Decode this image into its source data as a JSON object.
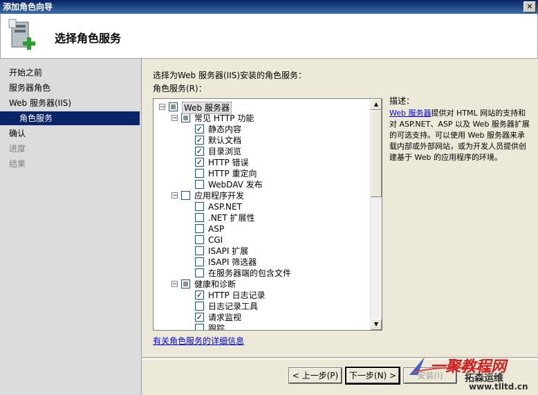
{
  "window": {
    "title": "添加角色向导",
    "close_symbol": "✕"
  },
  "header": {
    "title": "选择角色服务",
    "icon": "server-role-add-icon"
  },
  "nav": {
    "items": [
      {
        "label": "开始之前",
        "state": "normal"
      },
      {
        "label": "服务器角色",
        "state": "normal"
      },
      {
        "label": "Web 服务器(IIS)",
        "state": "normal"
      },
      {
        "label": "角色服务",
        "state": "selected"
      },
      {
        "label": "确认",
        "state": "normal"
      },
      {
        "label": "进度",
        "state": "disabled"
      },
      {
        "label": "结果",
        "state": "disabled"
      }
    ]
  },
  "main": {
    "instruction": "选择为Web 服务器(IIS)安装的角色服务：",
    "list_label": "角色服务(R)：",
    "more_info_link": "有关角色服务的详细信息"
  },
  "tree": {
    "items": [
      {
        "label": "Web 服务器",
        "level": 0,
        "expander": "⊟",
        "check": "partial",
        "selected": true
      },
      {
        "label": "常见 HTTP 功能",
        "level": 1,
        "expander": "⊟",
        "check": "partial"
      },
      {
        "label": "静态内容",
        "level": 2,
        "check": "checked"
      },
      {
        "label": "默认文档",
        "level": 2,
        "check": "checked"
      },
      {
        "label": "目录浏览",
        "level": 2,
        "check": "checked"
      },
      {
        "label": "HTTP 错误",
        "level": 2,
        "check": "checked"
      },
      {
        "label": "HTTP 重定向",
        "level": 2,
        "check": "unchecked"
      },
      {
        "label": "WebDAV 发布",
        "level": 2,
        "check": "unchecked"
      },
      {
        "label": "应用程序开发",
        "level": 1,
        "expander": "⊟",
        "check": "unchecked"
      },
      {
        "label": "ASP.NET",
        "level": 2,
        "check": "unchecked"
      },
      {
        "label": ".NET 扩展性",
        "level": 2,
        "check": "unchecked"
      },
      {
        "label": "ASP",
        "level": 2,
        "check": "unchecked"
      },
      {
        "label": "CGI",
        "level": 2,
        "check": "unchecked"
      },
      {
        "label": "ISAPI 扩展",
        "level": 2,
        "check": "unchecked"
      },
      {
        "label": "ISAPI 筛选器",
        "level": 2,
        "check": "unchecked"
      },
      {
        "label": "在服务器端的包含文件",
        "level": 2,
        "check": "unchecked"
      },
      {
        "label": "健康和诊断",
        "level": 1,
        "expander": "⊟",
        "check": "partial"
      },
      {
        "label": "HTTP 日志记录",
        "level": 2,
        "check": "checked"
      },
      {
        "label": "日志记录工具",
        "level": 2,
        "check": "unchecked"
      },
      {
        "label": "请求监视",
        "level": 2,
        "check": "checked"
      },
      {
        "label": "跟踪",
        "level": 2,
        "check": "unchecked"
      }
    ],
    "scroll_up": "▲",
    "scroll_down": "▼"
  },
  "description": {
    "heading": "描述：",
    "link": "Web 服务器",
    "text": "提供对 HTML 网站的支持和对 ASP.NET、ASP 以及 Web 服务器扩展的可选支持。可以使用 Web 服务器来承载内部或外部网站，或为开发人员提供创建基于 Web 的应用程序的环境。"
  },
  "buttons": {
    "prev": "< 上一步(P)",
    "next": "下一步(N) >",
    "install": "安装(I)"
  },
  "watermark": {
    "line1": "一聚教程网",
    "line2": "拓森运维",
    "url": "www.tlltd.cn"
  }
}
